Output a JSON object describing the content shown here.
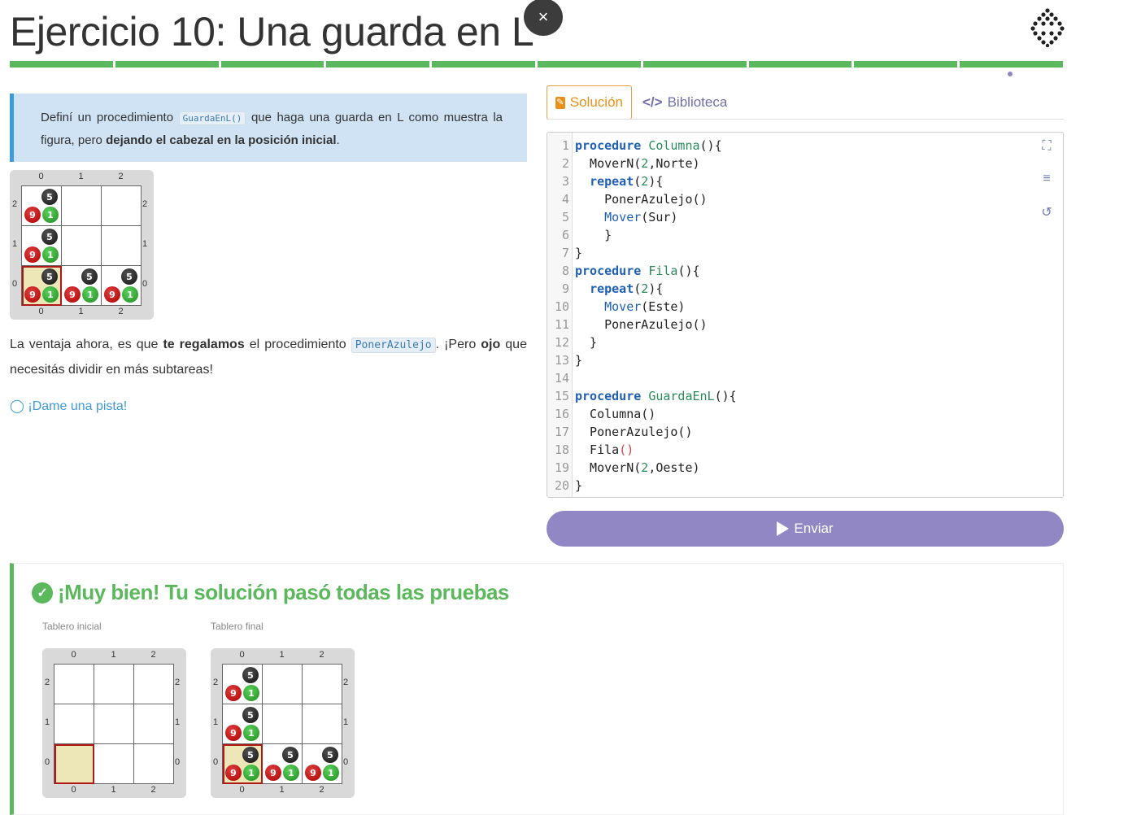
{
  "header": {
    "title": "Ejercicio 10: Una guarda en L",
    "close_label": "×",
    "progress_segments": 10
  },
  "statement": {
    "p1": "Definí un procedimiento",
    "code": "GuardaEnL()",
    "p2": "que haga una guarda en L como muestra la figura, pero",
    "bold": "dejando el cabezal en la posición inicial",
    "end": "."
  },
  "board_labels": {
    "cols": [
      "0",
      "1",
      "2"
    ],
    "rows": [
      "2",
      "1",
      "0"
    ]
  },
  "balls": {
    "black": "5",
    "red": "9",
    "green": "1"
  },
  "paragraph": {
    "t1": "La ventaja ahora, es que",
    "b1": "te regalamos",
    "t2": "el procedimiento",
    "code": "PonerAzulejo",
    "t3": ". ¡Pero",
    "b2": "ojo",
    "t4": "que necesitás dividir en más subtareas!"
  },
  "hint": "¡Dame una pista!",
  "tabs": {
    "solution": "Solución",
    "library": "Biblioteca",
    "library_icon": "</>"
  },
  "editor": {
    "lines": [
      "procedure Columna(){",
      "  MoverN(2,Norte)",
      "  repeat(2){",
      "    PonerAzulejo()",
      "    Mover(Sur)",
      "    }",
      "}",
      "procedure Fila(){",
      "  repeat(2){",
      "    Mover(Este)",
      "    PonerAzulejo()",
      "  }",
      "}",
      "",
      "procedure GuardaEnL(){",
      "  Columna()",
      "  PonerAzulejo()",
      "  Fila()",
      "  MoverN(2,Oeste)",
      "}"
    ],
    "colors": {
      "keyword": "#1f5fb4",
      "name": "#2a8a5a",
      "number": "#2a8a5a",
      "paren_error": "#d04040"
    }
  },
  "submit_label": "Enviar",
  "result": {
    "title": "¡Muy bien! Tu solución pasó todas las pruebas",
    "initial_label": "Tablero inicial",
    "final_label": "Tablero final"
  },
  "colors": {
    "green": "#5bb85d",
    "purple": "#9187c4",
    "orange": "#e8901a",
    "blue": "#3d9bd9"
  }
}
